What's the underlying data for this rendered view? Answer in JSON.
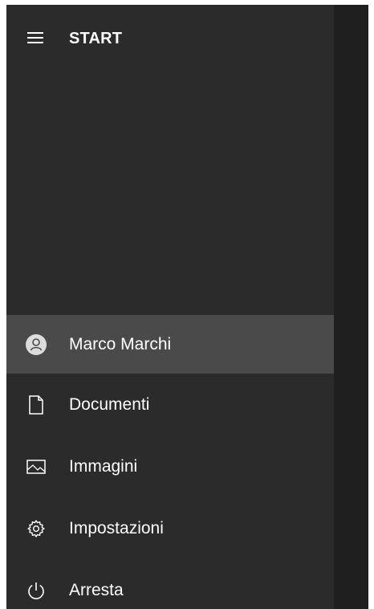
{
  "header": {
    "title": "START",
    "menu_icon": "hamburger-icon"
  },
  "nav": {
    "items": [
      {
        "label": "Marco Marchi",
        "icon": "user-avatar-icon",
        "selected": true
      },
      {
        "label": "Documenti",
        "icon": "document-icon",
        "selected": false
      },
      {
        "label": "Immagini",
        "icon": "image-icon",
        "selected": false
      },
      {
        "label": "Impostazioni",
        "icon": "gear-icon",
        "selected": false
      },
      {
        "label": "Arresta",
        "icon": "power-icon",
        "selected": false
      }
    ]
  },
  "colors": {
    "panel_bg": "#2b2b2b",
    "right_pane_bg": "#1f1f1f",
    "selected_bg": "#4a4a4a",
    "text": "#ffffff"
  }
}
